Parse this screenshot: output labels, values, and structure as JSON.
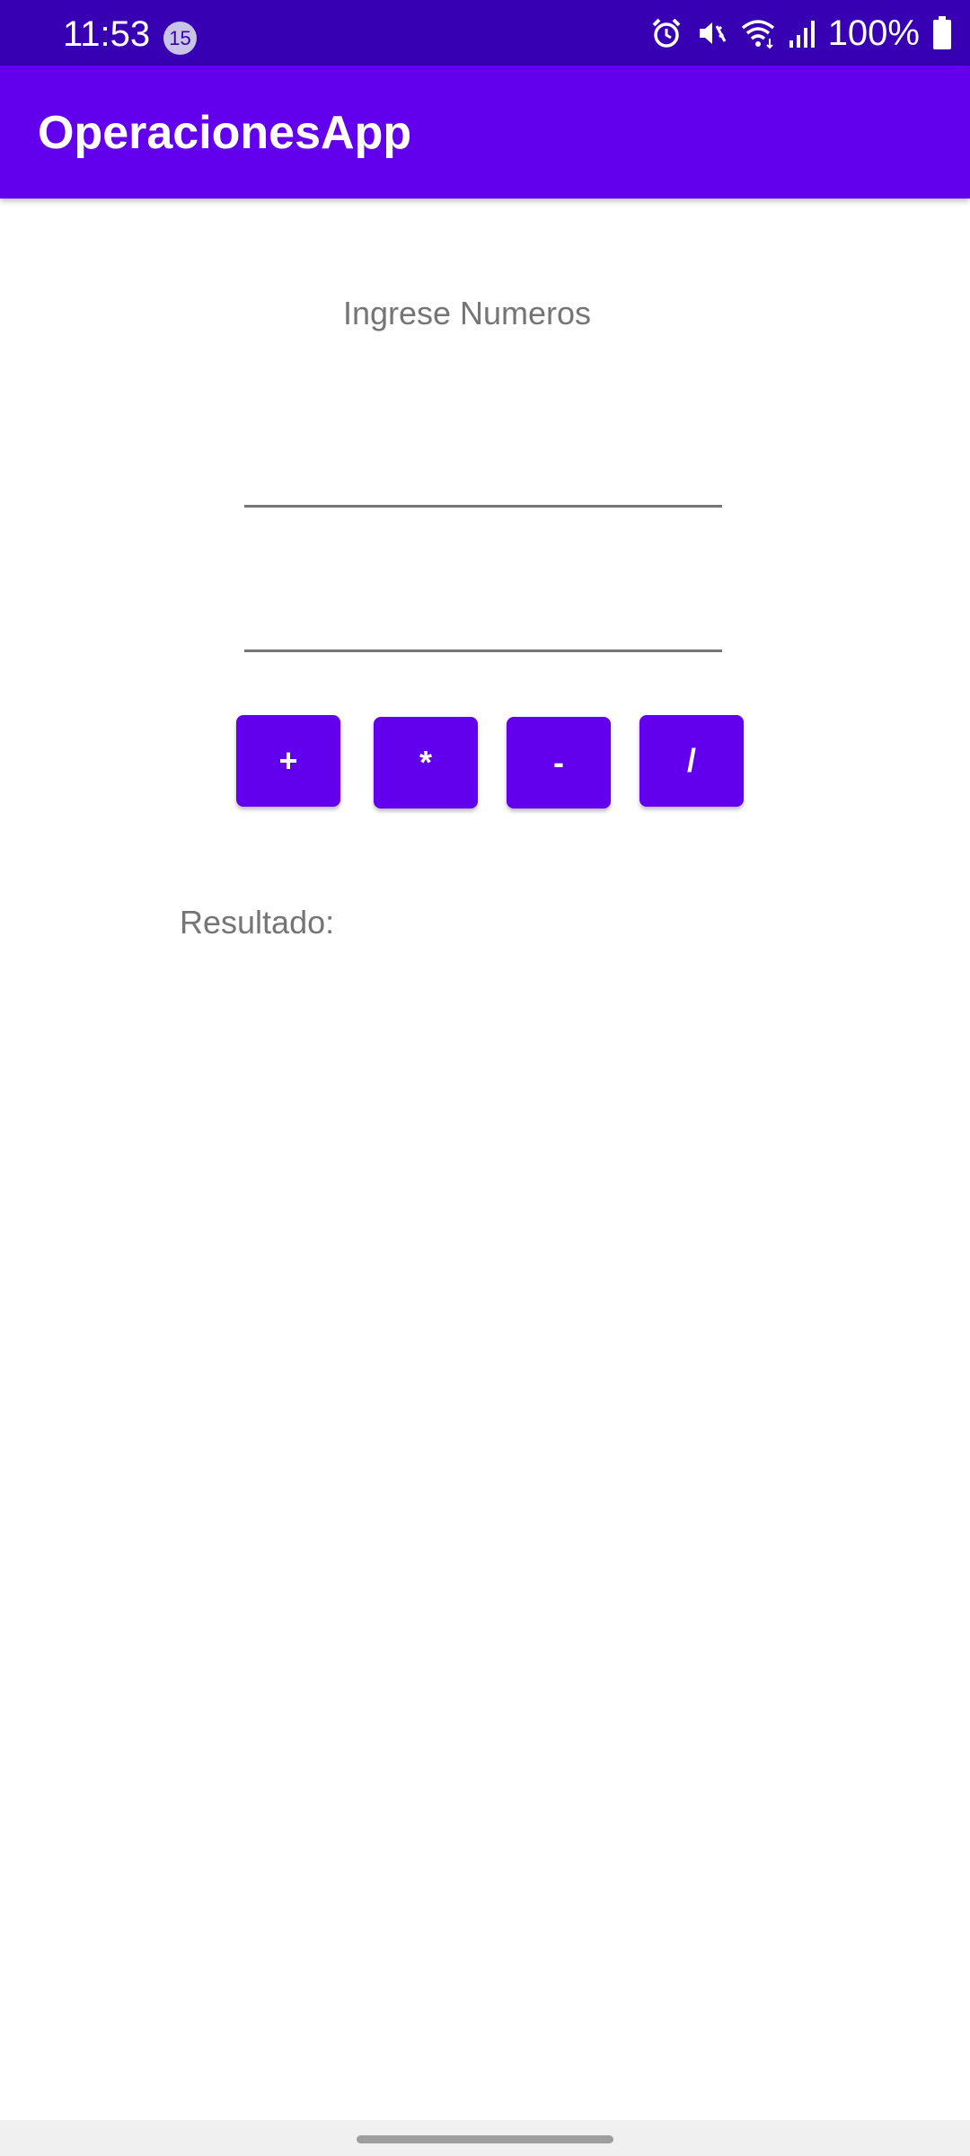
{
  "status_bar": {
    "time": "11:53",
    "notification_count": "15",
    "battery": "100%",
    "icons": [
      "alarm-icon",
      "mute-vibrate-icon",
      "wifi-icon",
      "signal-icon",
      "battery-icon"
    ]
  },
  "app_bar": {
    "title": "OperacionesApp",
    "color": "#6200ee"
  },
  "main": {
    "prompt": "Ingrese Numeros",
    "input1": {
      "value": "",
      "placeholder": ""
    },
    "input2": {
      "value": "",
      "placeholder": ""
    },
    "buttons": {
      "add": "+",
      "multiply": "*",
      "subtract": "-",
      "divide": "/"
    },
    "result_label": "Resultado:"
  },
  "colors": {
    "primary": "#6200ee",
    "primary_dark": "#3700b3",
    "text_secondary": "#757575"
  }
}
